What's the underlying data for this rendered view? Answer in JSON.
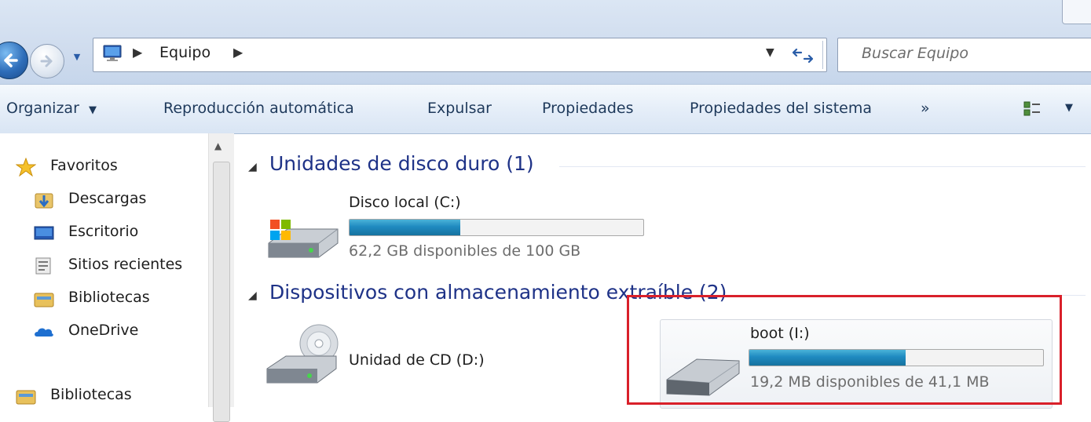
{
  "window": {
    "search_placeholder": "Buscar Equipo"
  },
  "address_bar": {
    "breadcrumb": [
      "Equipo"
    ]
  },
  "toolbar": {
    "organize": "Organizar",
    "autoplay": "Reproducción automática",
    "eject": "Expulsar",
    "properties": "Propiedades",
    "system_properties": "Propiedades del sistema",
    "more": "»"
  },
  "navigation": {
    "items": [
      {
        "label": "Favoritos",
        "icon": "star-icon"
      },
      {
        "label": "Descargas",
        "icon": "downloads-folder-icon"
      },
      {
        "label": "Escritorio",
        "icon": "desktop-icon"
      },
      {
        "label": "Sitios recientes",
        "icon": "recent-places-icon"
      },
      {
        "label": "Bibliotecas",
        "icon": "libraries-icon"
      },
      {
        "label": "OneDrive",
        "icon": "onedrive-icon"
      },
      {
        "label": "Bibliotecas",
        "icon": "libraries-icon"
      }
    ]
  },
  "content": {
    "hard_drives_header": "Unidades de disco duro (1)",
    "removable_header": "Dispositivos con almacenamiento extraíble (2)",
    "drives": [
      {
        "name": "Disco local (C:)",
        "free_text": "62,2 GB disponibles de 100 GB",
        "used_fraction": 0.378
      },
      {
        "name": "Unidad de CD (D:)"
      },
      {
        "name": "boot (I:)",
        "free_text": "19,2 MB disponibles de 41,1 MB",
        "used_fraction": 0.533
      }
    ]
  },
  "colors": {
    "highlight_border": "#d9202a",
    "group_header": "#1e3287",
    "bar_fill": "#1f8ac0"
  }
}
